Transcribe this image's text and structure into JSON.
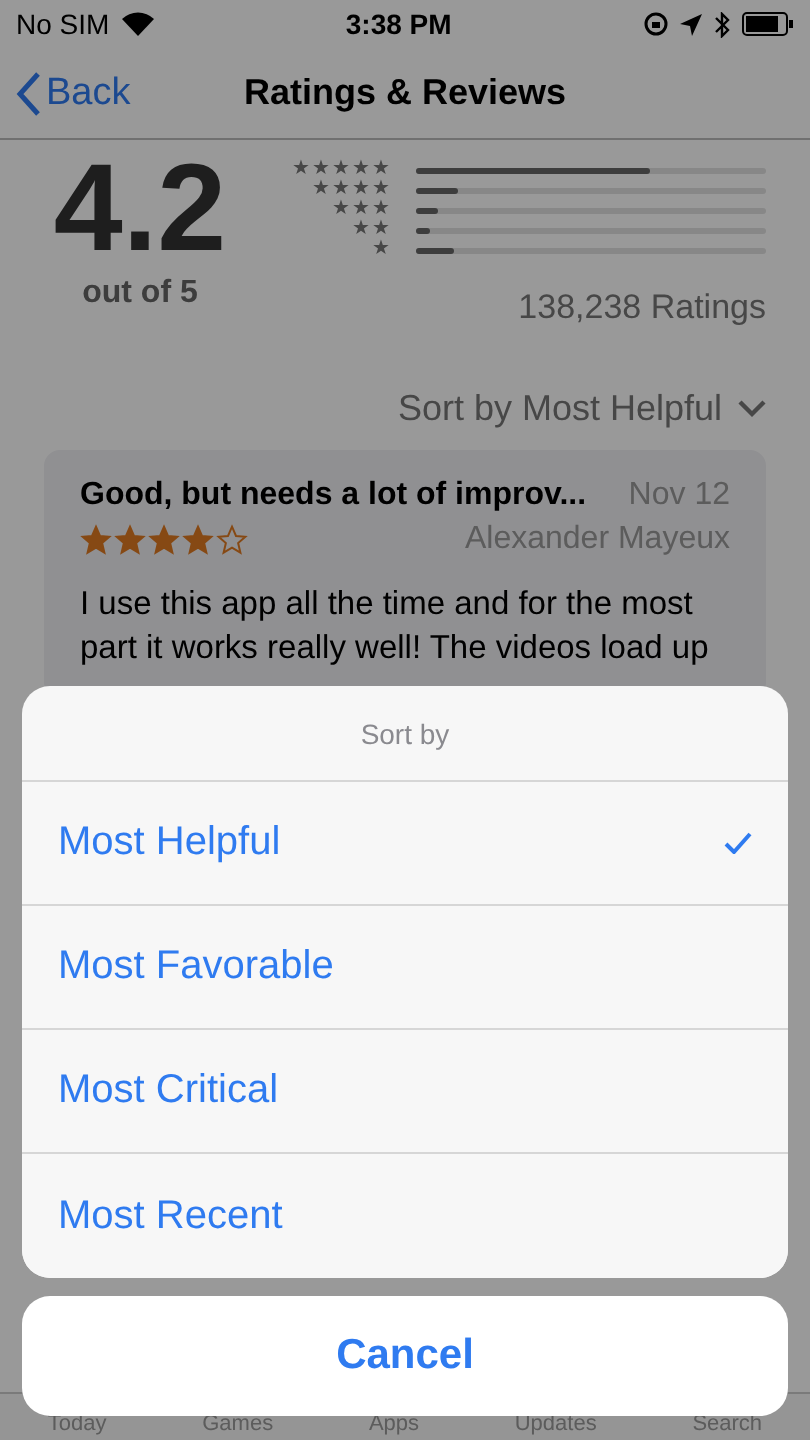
{
  "status_bar": {
    "carrier": "No SIM",
    "time": "3:38 PM"
  },
  "nav": {
    "back": "Back",
    "title": "Ratings & Reviews"
  },
  "summary": {
    "score": "4.2",
    "out_of": "out of 5",
    "count": "138,238 Ratings",
    "histogram": [
      {
        "label": "★★★★★",
        "level": 0.67
      },
      {
        "label": "★★★★",
        "level": 0.12
      },
      {
        "label": "★★★",
        "level": 0.06
      },
      {
        "label": "★★",
        "level": 0.04
      },
      {
        "label": "★",
        "level": 0.11
      }
    ]
  },
  "sort_label": "Sort by Most Helpful",
  "review": {
    "title": "Good, but needs a lot of improv...",
    "date": "Nov 12",
    "stars": 4,
    "author": "Alexander Mayeux",
    "body": "I use this app all the time and for the most part it works really well! The videos load up"
  },
  "tabs": [
    {
      "label": "Today"
    },
    {
      "label": "Games"
    },
    {
      "label": "Apps"
    },
    {
      "label": "Updates"
    },
    {
      "label": "Search"
    }
  ],
  "sheet": {
    "title": "Sort by",
    "options": [
      {
        "label": "Most Helpful",
        "selected": true
      },
      {
        "label": "Most Favorable",
        "selected": false
      },
      {
        "label": "Most Critical",
        "selected": false
      },
      {
        "label": "Most Recent",
        "selected": false
      }
    ],
    "cancel": "Cancel"
  }
}
